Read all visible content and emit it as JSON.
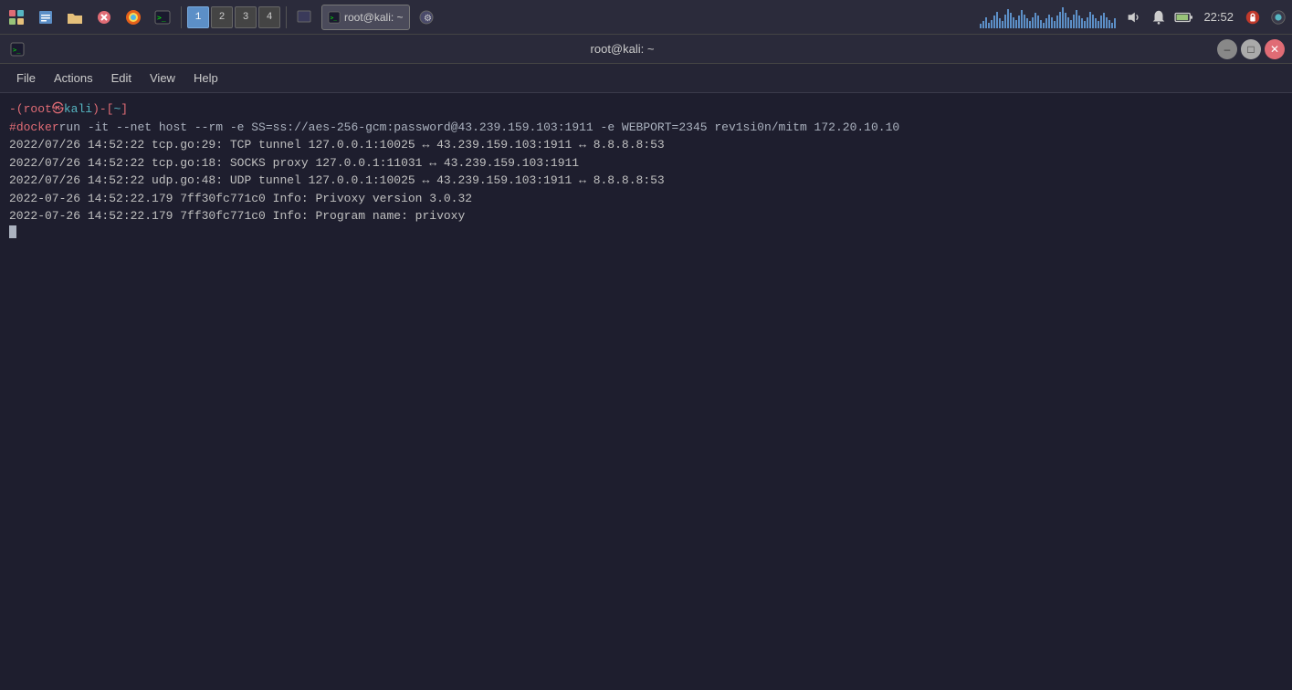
{
  "taskbar": {
    "workspaces": [
      "1",
      "2",
      "3",
      "4"
    ],
    "active_workspace": "1",
    "clock": "22:52",
    "app_label": "root@kali: ~"
  },
  "terminal": {
    "title": "root@kali: ~",
    "menu_items": [
      "File",
      "Actions",
      "Edit",
      "View",
      "Help"
    ],
    "prompt": {
      "bracket_open": "-(",
      "user": "root",
      "at": "㉿",
      "host": "kali",
      "bracket_close": ")-[",
      "dir": "~",
      "dir_bracket_close": "]",
      "hash": "#"
    },
    "command": "docker run -it --net host --rm -e SS=ss://aes-256-gcm:password@43.239.159.103:1911 -e WEBPORT=2345 rev1si0n/mitm 172.20.10.10",
    "log_lines": [
      "2022/07/26 14:52:22 tcp.go:29: TCP tunnel 127.0.0.1:10025 ↔ 43.239.159.103:1911 ↔ 8.8.8.8:53",
      "2022/07/26 14:52:22 tcp.go:18: SOCKS proxy 127.0.0.1:11031 ↔ 43.239.159.103:1911",
      "2022/07/26 14:52:22 udp.go:48: UDP tunnel 127.0.0.1:10025 ↔ 43.239.159.103:1911 ↔ 8.8.8.8:53",
      "2022-07-26 14:52:22.179 7ff30fc771c0 Info: Privoxy version 3.0.32",
      "2022-07-26 14:52:22.179 7ff30fc771c0 Info: Program name: privoxy"
    ]
  },
  "chart_bars": [
    3,
    5,
    8,
    4,
    6,
    9,
    12,
    7,
    5,
    10,
    14,
    11,
    8,
    6,
    9,
    13,
    10,
    7,
    5,
    8,
    11,
    9,
    6,
    4,
    7,
    10,
    8,
    5,
    9,
    12,
    15,
    11,
    8,
    6,
    10,
    13,
    9,
    7,
    5,
    8,
    12,
    10,
    7,
    5,
    9,
    11,
    8,
    6,
    4,
    7
  ]
}
